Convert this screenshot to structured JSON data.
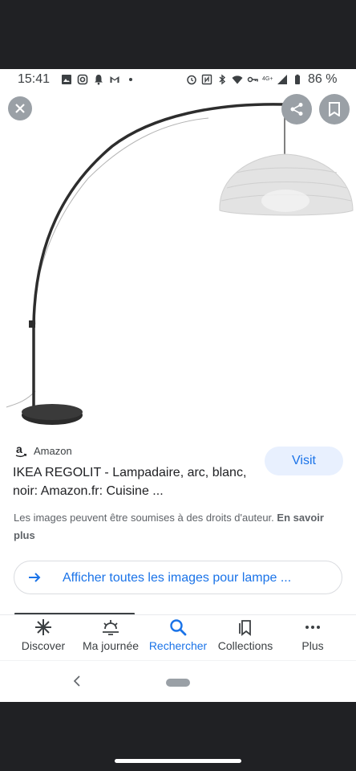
{
  "status_bar": {
    "time": "15:41",
    "battery": "86 %",
    "network": "4G+",
    "left_icons": [
      "gallery-icon",
      "instagram-icon",
      "bell-icon",
      "gmail-icon",
      "dot-icon"
    ],
    "right_icons": [
      "alarm-icon",
      "nfc-icon",
      "bluetooth-icon",
      "wifi-icon",
      "vpn-key-icon",
      "signal-icon",
      "battery-icon"
    ]
  },
  "viewer": {
    "close_icon": "close-icon",
    "share_icon": "share-icon",
    "bookmark_icon": "bookmark-icon"
  },
  "result": {
    "source_name": "Amazon",
    "title": "IKEA REGOLIT - Lampadaire, arc, blanc, noir: Amazon.fr: Cuisine ...",
    "visit_label": "Visit",
    "copyright_text": "Les images peuvent être soumises à des droits d'auteur.",
    "learn_more_label": "En savoir plus",
    "more_images_label": "Afficher toutes les images pour lampe ..."
  },
  "bottom_nav": {
    "items": [
      {
        "label": "Discover",
        "icon": "asterisk-icon",
        "active": false
      },
      {
        "label": "Ma journée",
        "icon": "sunrise-icon",
        "active": false
      },
      {
        "label": "Rechercher",
        "icon": "search-icon",
        "active": true
      },
      {
        "label": "Collections",
        "icon": "collections-icon",
        "active": false
      },
      {
        "label": "Plus",
        "icon": "more-icon",
        "active": false
      }
    ]
  },
  "colors": {
    "accent": "#1a73e8",
    "visit_bg": "#e8f0fe",
    "text": "#202124",
    "secondary_text": "#5f6368"
  }
}
